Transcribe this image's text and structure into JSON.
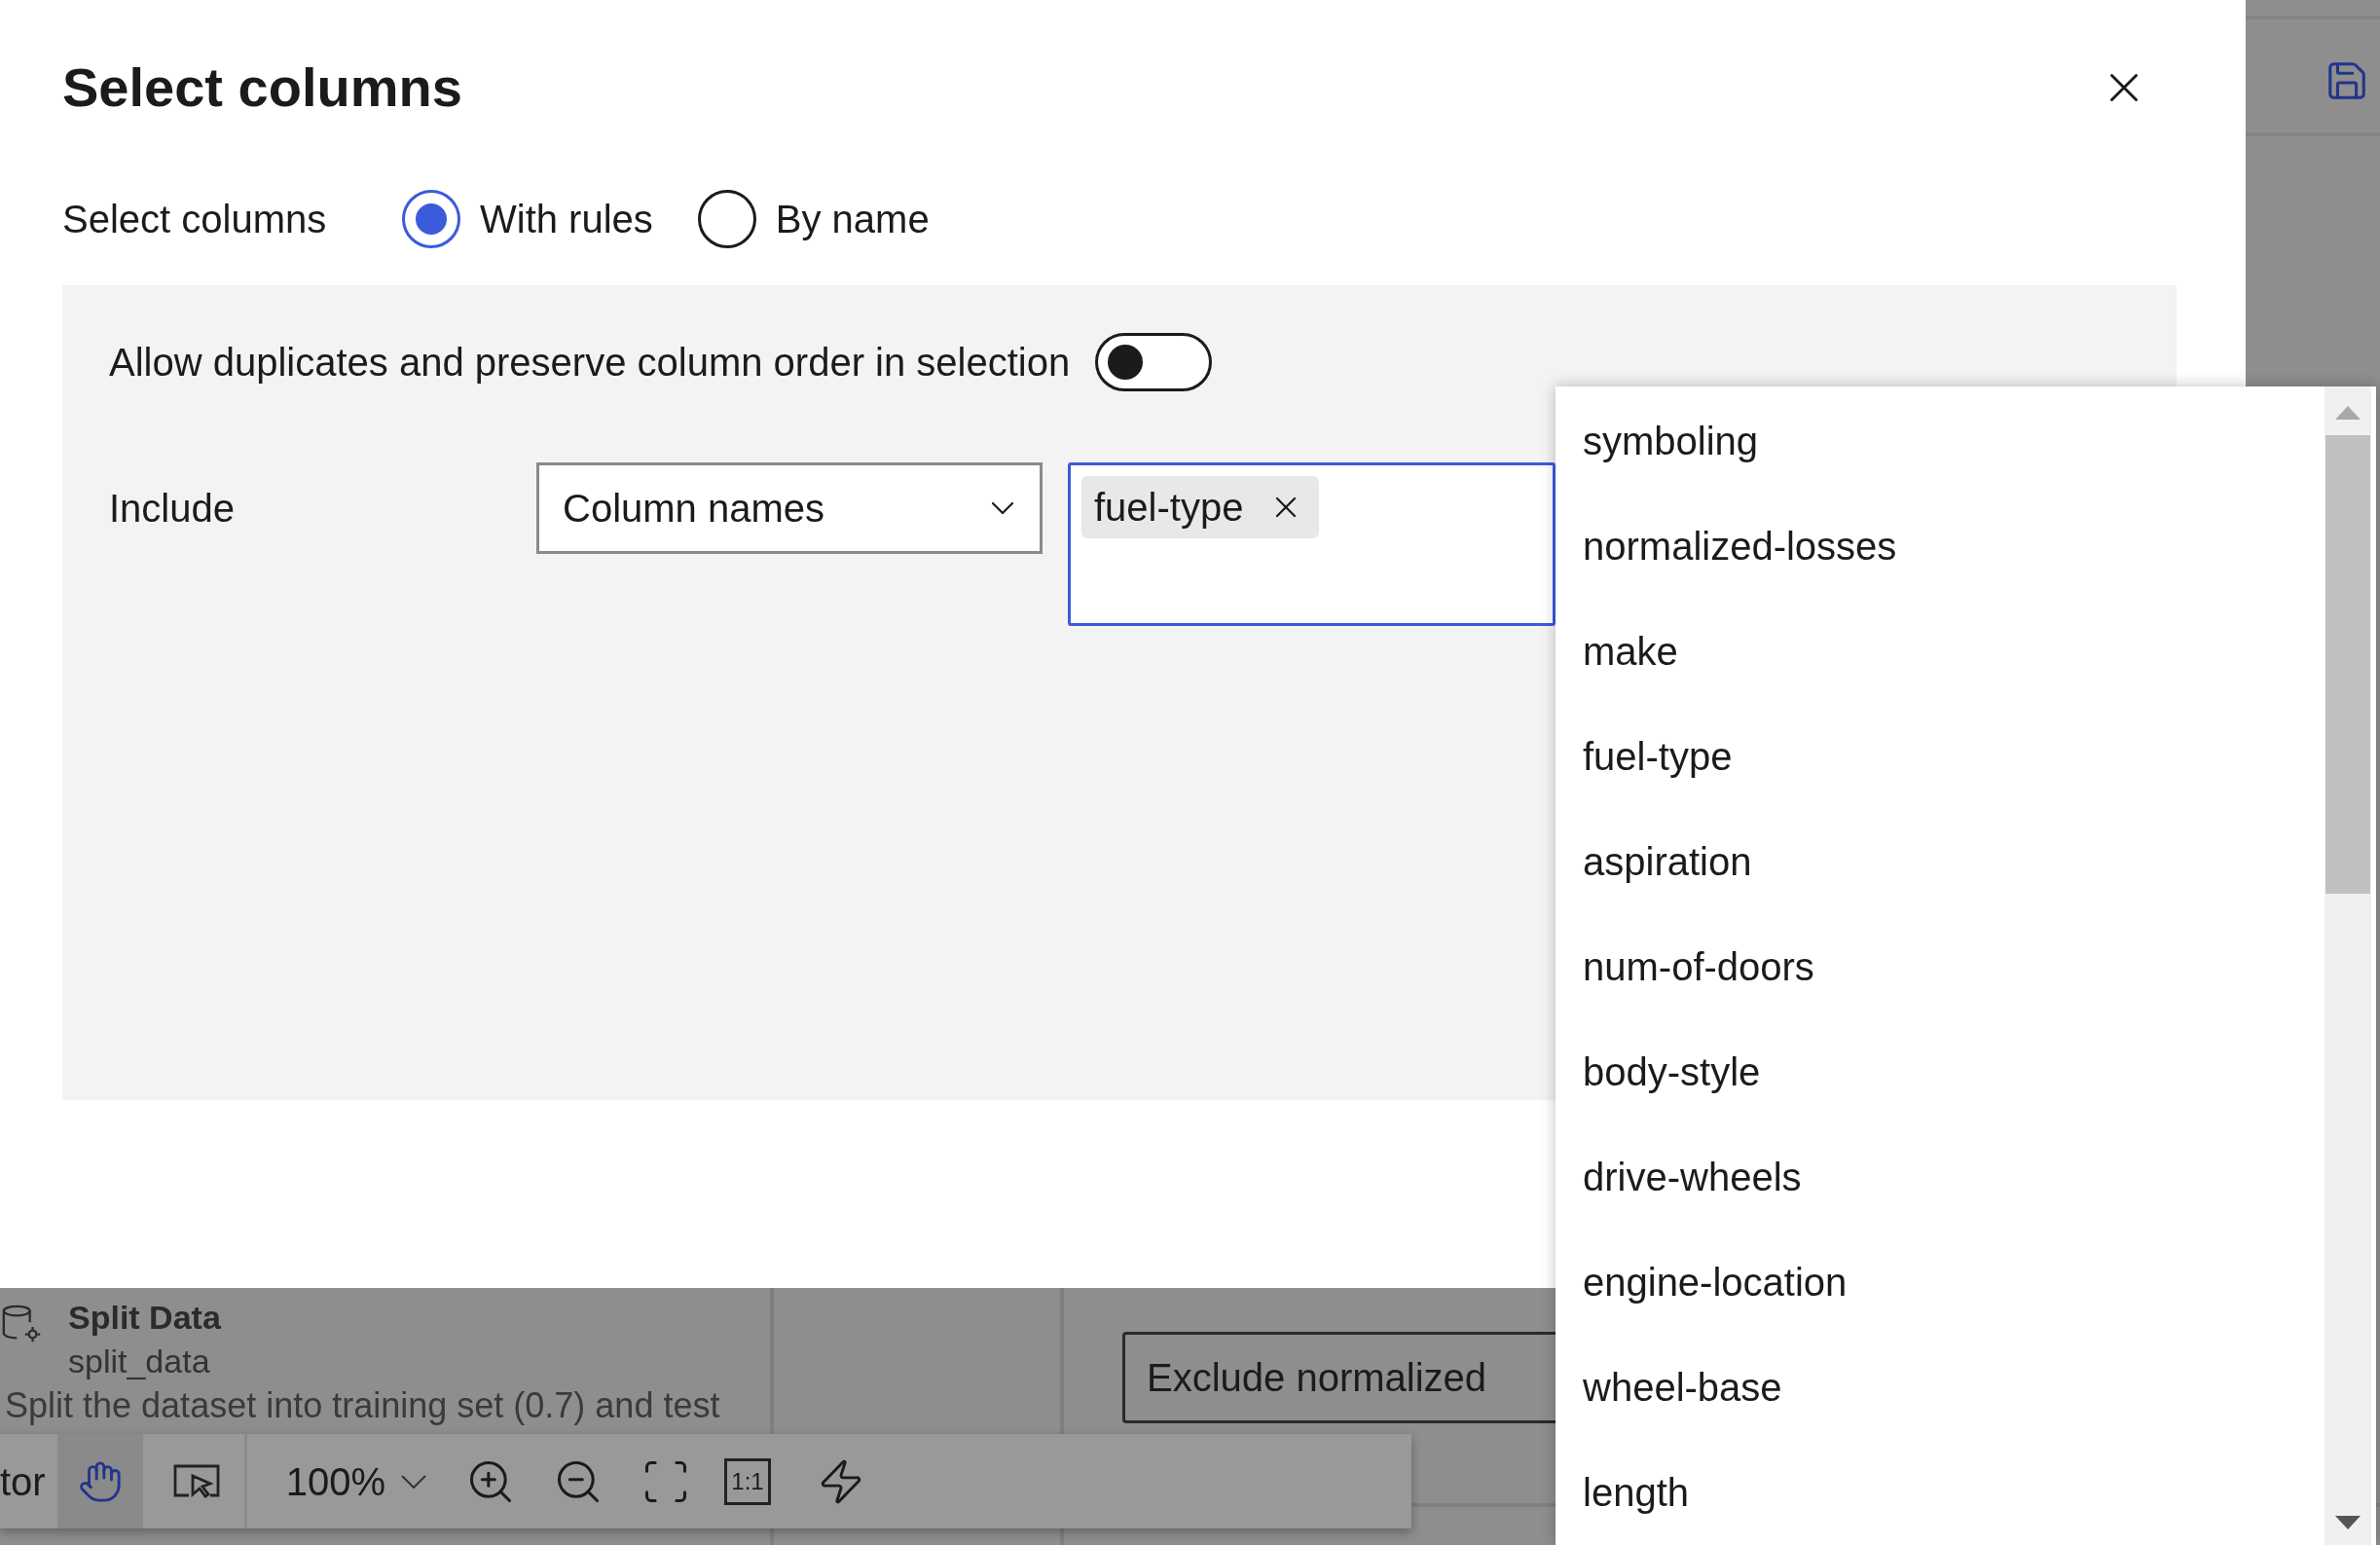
{
  "dialog": {
    "title": "Select columns",
    "selection_mode": {
      "label": "Select columns",
      "options": [
        {
          "label": "With rules",
          "selected": true
        },
        {
          "label": "By name",
          "selected": false
        }
      ]
    },
    "rules": {
      "allow_duplicates": {
        "label": "Allow duplicates and preserve column order in selection",
        "on": false
      },
      "include": {
        "label": "Include",
        "dropdown": "Column names",
        "tags": [
          {
            "label": "fuel-type"
          }
        ]
      }
    }
  },
  "column_list": {
    "items": [
      {
        "label": "symboling"
      },
      {
        "label": "normalized-losses"
      },
      {
        "label": "make"
      },
      {
        "label": "fuel-type"
      },
      {
        "label": "aspiration"
      },
      {
        "label": "num-of-doors"
      },
      {
        "label": "body-style"
      },
      {
        "label": "drive-wheels"
      },
      {
        "label": "engine-location"
      },
      {
        "label": "wheel-base"
      },
      {
        "label": "length"
      }
    ]
  },
  "background": {
    "module": {
      "title": "Split Data",
      "name": "split_data",
      "description": "Split the dataset into training set (0.7) and test"
    },
    "toolbar": {
      "cut_label": "tor",
      "zoom": "100%",
      "actual_size": "1:1"
    },
    "comment_field": {
      "value": "Exclude normalized"
    }
  }
}
